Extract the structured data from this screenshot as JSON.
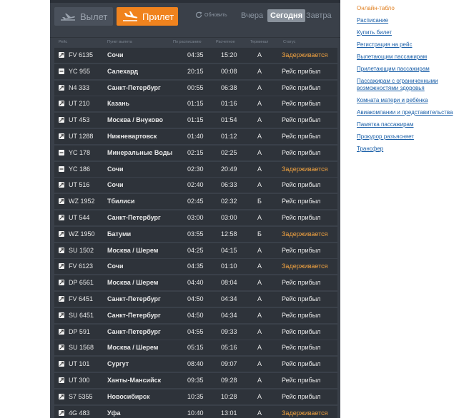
{
  "tabs": {
    "departures": "Вылет",
    "arrivals": "Прилет"
  },
  "refresh_label": "Обновить",
  "days": {
    "yesterday": "Вчера",
    "today": "Сегодня",
    "tomorrow": "Завтра"
  },
  "columns": {
    "flight": "Рейс",
    "from": "Пункт вылета",
    "scheduled": "По расписанию",
    "estimated": "Расчетное",
    "terminal": "Терминал",
    "status": "Статус"
  },
  "rows": [
    {
      "flight": "FV 6135",
      "city": "Сочи",
      "scheduled": "04:35",
      "estimated": "15:20",
      "terminal": "А",
      "status": "Задерживается",
      "delayed": true,
      "icon": "checkbox-plane-icon"
    },
    {
      "flight": "YC 955",
      "city": "Салехард",
      "scheduled": "20:15",
      "estimated": "00:08",
      "terminal": "А",
      "status": "Рейс прибыл",
      "delayed": false,
      "icon": "checkbox-dash-icon"
    },
    {
      "flight": "N4 333",
      "city": "Санкт-Петербург",
      "scheduled": "00:55",
      "estimated": "06:38",
      "terminal": "А",
      "status": "Рейс прибыл",
      "delayed": false,
      "icon": "checkbox-plane-icon"
    },
    {
      "flight": "UT 210",
      "city": "Казань",
      "scheduled": "01:15",
      "estimated": "01:16",
      "terminal": "А",
      "status": "Рейс прибыл",
      "delayed": false,
      "icon": "checkbox-plane-icon"
    },
    {
      "flight": "UT 453",
      "city": "Москва / Внуково",
      "scheduled": "01:15",
      "estimated": "01:54",
      "terminal": "А",
      "status": "Рейс прибыл",
      "delayed": false,
      "icon": "checkbox-plane-icon"
    },
    {
      "flight": "UT 1288",
      "city": "Нижневартовск",
      "scheduled": "01:40",
      "estimated": "01:12",
      "terminal": "А",
      "status": "Рейс прибыл",
      "delayed": false,
      "icon": "checkbox-plane-icon"
    },
    {
      "flight": "YC 178",
      "city": "Минеральные Воды",
      "scheduled": "02:15",
      "estimated": "02:25",
      "terminal": "А",
      "status": "Рейс прибыл",
      "delayed": false,
      "icon": "checkbox-dash-icon"
    },
    {
      "flight": "YC 186",
      "city": "Сочи",
      "scheduled": "02:30",
      "estimated": "20:49",
      "terminal": "А",
      "status": "Задерживается",
      "delayed": true,
      "icon": "checkbox-dash-icon"
    },
    {
      "flight": "UT 516",
      "city": "Сочи",
      "scheduled": "02:40",
      "estimated": "06:33",
      "terminal": "А",
      "status": "Рейс прибыл",
      "delayed": false,
      "icon": "checkbox-plane-icon"
    },
    {
      "flight": "WZ 1952",
      "city": "Тбилиси",
      "scheduled": "02:45",
      "estimated": "02:32",
      "terminal": "Б",
      "status": "Рейс прибыл",
      "delayed": false,
      "icon": "checkbox-plane-icon"
    },
    {
      "flight": "UT 544",
      "city": "Санкт-Петербург",
      "scheduled": "03:00",
      "estimated": "03:00",
      "terminal": "А",
      "status": "Рейс прибыл",
      "delayed": false,
      "icon": "checkbox-plane-icon"
    },
    {
      "flight": "WZ 1950",
      "city": "Батуми",
      "scheduled": "03:55",
      "estimated": "12:58",
      "terminal": "Б",
      "status": "Задерживается",
      "delayed": true,
      "icon": "checkbox-plane-icon"
    },
    {
      "flight": "SU 1502",
      "city": "Москва / Шерем",
      "scheduled": "04:25",
      "estimated": "04:15",
      "terminal": "А",
      "status": "Рейс прибыл",
      "delayed": false,
      "icon": "checkbox-plane-icon"
    },
    {
      "flight": "FV 6123",
      "city": "Сочи",
      "scheduled": "04:35",
      "estimated": "01:10",
      "terminal": "А",
      "status": "Задерживается",
      "delayed": true,
      "icon": "checkbox-plane-icon"
    },
    {
      "flight": "DP 6561",
      "city": "Москва / Шерем",
      "scheduled": "04:40",
      "estimated": "08:04",
      "terminal": "А",
      "status": "Рейс прибыл",
      "delayed": false,
      "icon": "checkbox-plane-icon"
    },
    {
      "flight": "FV 6451",
      "city": "Санкт-Петербург",
      "scheduled": "04:50",
      "estimated": "04:34",
      "terminal": "А",
      "status": "Рейс прибыл",
      "delayed": false,
      "icon": "checkbox-plane-icon"
    },
    {
      "flight": "SU 6451",
      "city": "Санкт-Петербург",
      "scheduled": "04:50",
      "estimated": "04:34",
      "terminal": "А",
      "status": "Рейс прибыл",
      "delayed": false,
      "icon": "checkbox-plane-icon"
    },
    {
      "flight": "DP 591",
      "city": "Санкт-Петербург",
      "scheduled": "04:55",
      "estimated": "09:33",
      "terminal": "А",
      "status": "Рейс прибыл",
      "delayed": false,
      "icon": "checkbox-plane-icon"
    },
    {
      "flight": "SU 1568",
      "city": "Москва / Шерем",
      "scheduled": "05:15",
      "estimated": "05:16",
      "terminal": "А",
      "status": "Рейс прибыл",
      "delayed": false,
      "icon": "checkbox-plane-icon"
    },
    {
      "flight": "UT 101",
      "city": "Сургут",
      "scheduled": "08:40",
      "estimated": "09:07",
      "terminal": "А",
      "status": "Рейс прибыл",
      "delayed": false,
      "icon": "checkbox-plane-icon"
    },
    {
      "flight": "UT 300",
      "city": "Ханты-Мансийск",
      "scheduled": "09:35",
      "estimated": "09:28",
      "terminal": "А",
      "status": "Рейс прибыл",
      "delayed": false,
      "icon": "checkbox-plane-icon"
    },
    {
      "flight": "S7 5355",
      "city": "Новосибирск",
      "scheduled": "10:35",
      "estimated": "10:28",
      "terminal": "А",
      "status": "Рейс прибыл",
      "delayed": false,
      "icon": "checkbox-plane-icon"
    },
    {
      "flight": "4G 483",
      "city": "Уфа",
      "scheduled": "10:40",
      "estimated": "13:01",
      "terminal": "А",
      "status": "Задерживается",
      "delayed": true,
      "icon": "checkbox-plane-icon"
    }
  ],
  "sidebar": {
    "items": [
      {
        "label": "Онлайн-табло",
        "active": true
      },
      {
        "label": "Расписание",
        "active": false
      },
      {
        "label": "Купить билет",
        "active": false
      },
      {
        "label": "Регистрация на рейс",
        "active": false
      },
      {
        "label": "Вылетающим пассажирам",
        "active": false
      },
      {
        "label": "Прилетающим пассажирам",
        "active": false
      },
      {
        "label": "Пассажирам с ограниченными возможностями здоровья",
        "active": false
      },
      {
        "label": "Комната матери и ребёнка",
        "active": false
      },
      {
        "label": "Авиакомпании и представительства",
        "active": false
      },
      {
        "label": "Памятка пассажирам",
        "active": false
      },
      {
        "label": "Прокурор разъясняет",
        "active": false
      },
      {
        "label": "Трансфер",
        "active": false
      }
    ]
  },
  "colors": {
    "board_bg": "#3a4049",
    "row_bg": "#2e333a",
    "accent": "#f0831e",
    "delayed": "#f2a340",
    "link": "#1a5fa8"
  }
}
